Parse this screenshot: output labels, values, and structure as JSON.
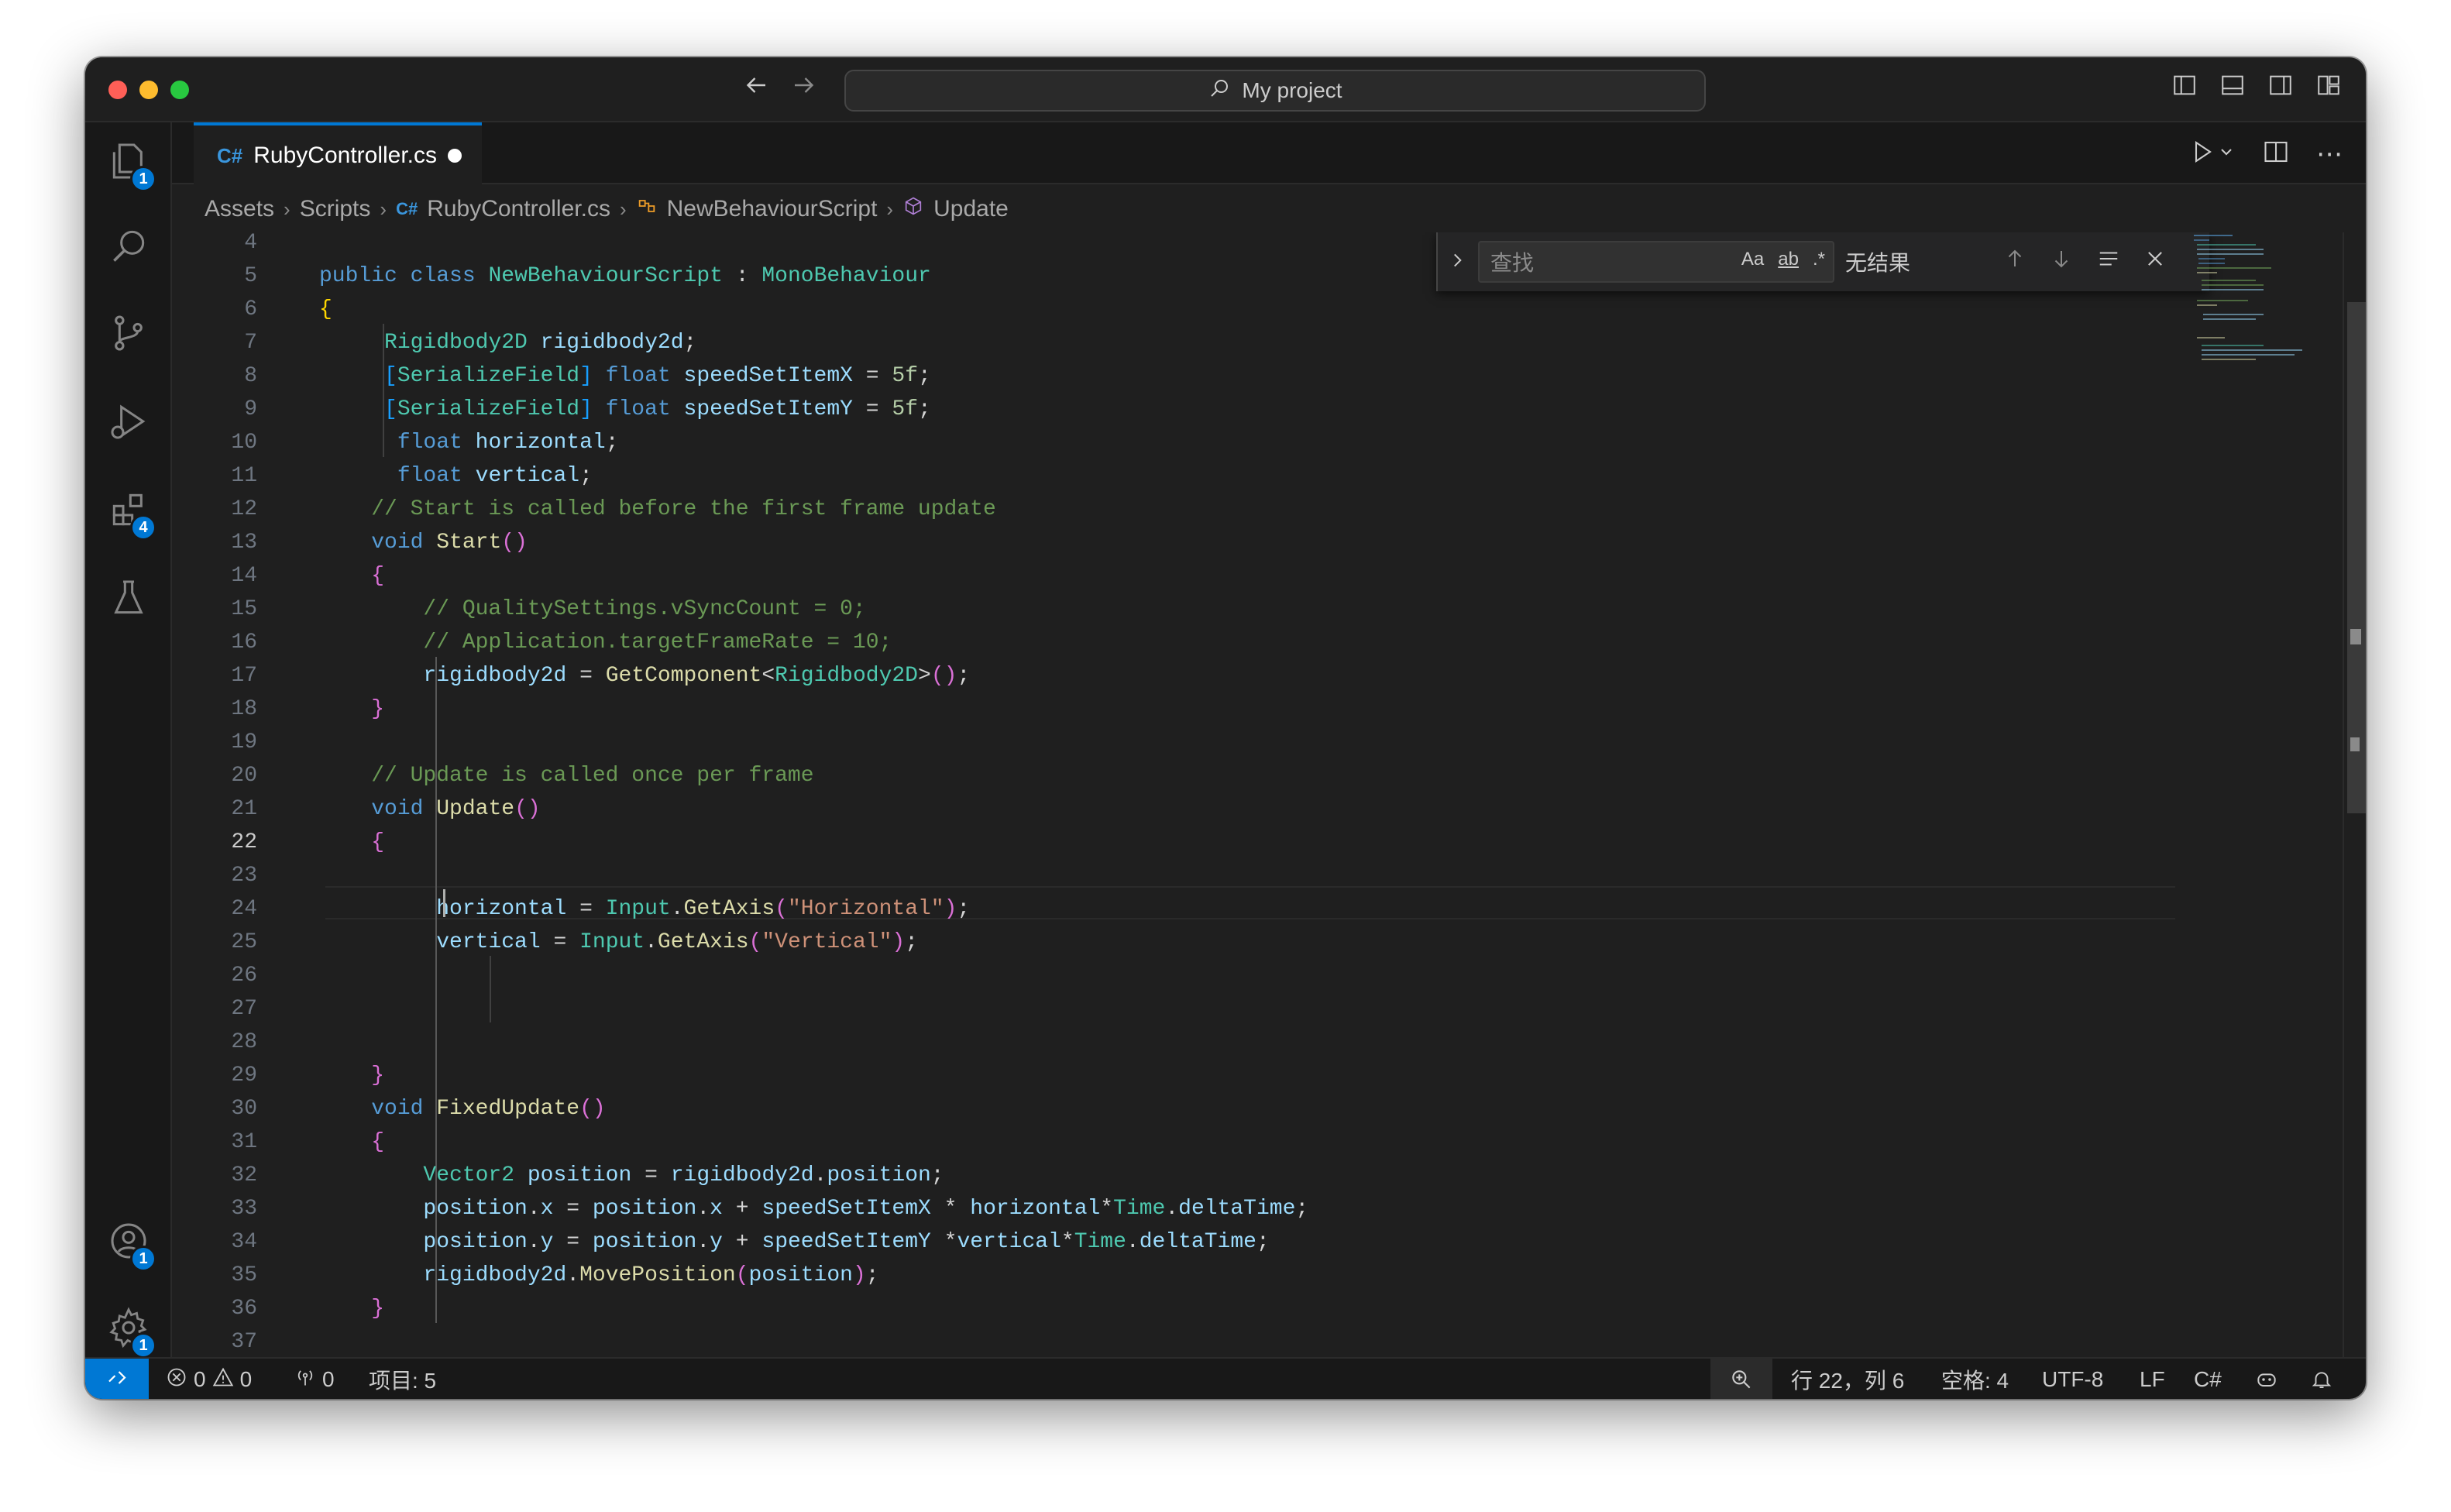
{
  "window": {
    "search_label": "My project"
  },
  "activity": {
    "explorer_badge": "1",
    "extensions_badge": "4",
    "accounts_badge": "1",
    "settings_badge": "1"
  },
  "tab": {
    "filename": "RubyController.cs",
    "lang_icon": "C#"
  },
  "breadcrumbs": [
    "Assets",
    "Scripts",
    "RubyController.cs",
    "NewBehaviourScript",
    "Update"
  ],
  "find": {
    "placeholder": "查找",
    "match_case": "Aa",
    "whole_word": "ab",
    "regex": ".*",
    "result": "无结果"
  },
  "editor": {
    "active_line": 22,
    "line_numbers": [
      "4",
      "5",
      "6",
      "7",
      "8",
      "9",
      "10",
      "11",
      "12",
      "13",
      "14",
      "15",
      "16",
      "17",
      "18",
      "19",
      "20",
      "21",
      "22",
      "23",
      "24",
      "25",
      "26",
      "27",
      "28",
      "29",
      "30",
      "31",
      "32",
      "33",
      "34",
      "35",
      "36",
      "37"
    ],
    "lines": [
      "",
      "public class NewBehaviourScript : MonoBehaviour",
      "{",
      "     Rigidbody2D rigidbody2d;",
      "     [SerializeField] float speedSetItemX = 5f;",
      "     [SerializeField] float speedSetItemY = 5f;",
      "      float horizontal;",
      "      float vertical;",
      "    // Start is called before the first frame update",
      "    void Start()",
      "    {",
      "        // QualitySettings.vSyncCount = 0;",
      "        // Application.targetFrameRate = 10;",
      "        rigidbody2d = GetComponent<Rigidbody2D>();",
      "    }",
      "",
      "    // Update is called once per frame",
      "    void Update()",
      "    {",
      "",
      "         horizontal = Input.GetAxis(\"Horizontal\");",
      "         vertical = Input.GetAxis(\"Vertical\");",
      "",
      "",
      "",
      "    }",
      "    void FixedUpdate()",
      "    {",
      "        Vector2 position = rigidbody2d.position;",
      "        position.x = position.x + speedSetItemX * horizontal*Time.deltaTime;",
      "        position.y = position.y + speedSetItemY *vertical*Time.deltaTime;",
      "        rigidbody2d.MovePosition(position);",
      "    }",
      ""
    ]
  },
  "status": {
    "errors": "0",
    "warnings": "0",
    "ports": "0",
    "projects": "项目: 5",
    "position": "行 22，列 6",
    "spaces": "空格: 4",
    "encoding": "UTF-8",
    "eol": "LF",
    "language": "C#"
  },
  "colors": {
    "accent": "#0078d4",
    "keyword": "#569cd6",
    "type": "#4ec9b0",
    "function": "#dcdcaa",
    "variable": "#9cdcfe",
    "comment": "#6a9955",
    "string": "#ce9178"
  }
}
